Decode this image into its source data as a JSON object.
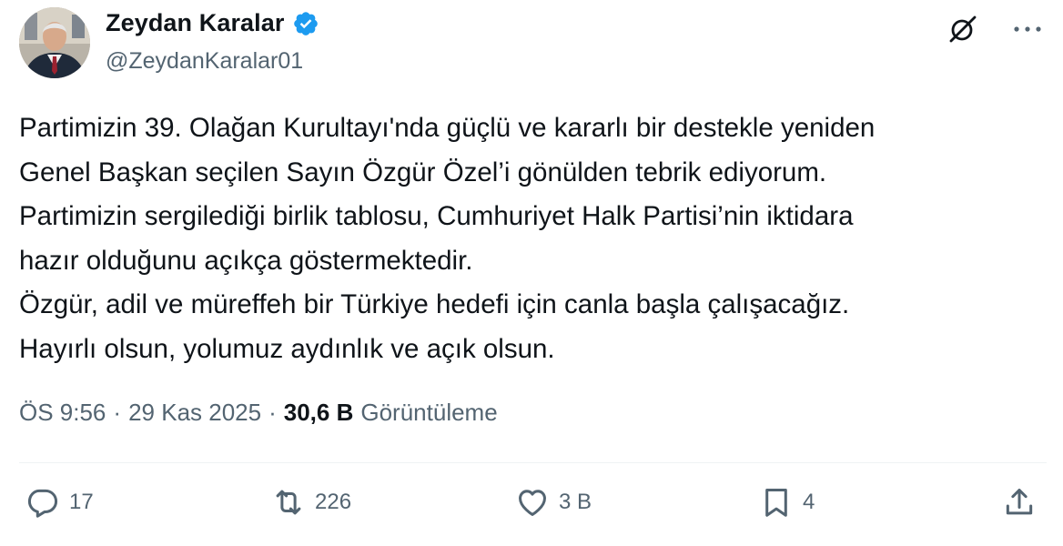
{
  "author": {
    "name": "Zeydan Karalar",
    "handle": "@ZeydanKaralar01",
    "verified": true,
    "verified_color": "#1d9bf0"
  },
  "tweet": {
    "text": "Partimizin 39. Olağan Kurultayı'nda güçlü ve kararlı bir destekle yeniden\nGenel Başkan seçilen Sayın Özgür Özel’i gönülden tebrik ediyorum.\nPartimizin sergilediği birlik tablosu, Cumhuriyet Halk Partisi’nin iktidara\nhazır olduğunu açıkça göstermektedir.\nÖzgür, adil ve müreffeh bir Türkiye hedefi için canla başla çalışacağız.\nHayırlı olsun, yolumuz aydınlık ve açık olsun."
  },
  "meta": {
    "time": "ÖS 9:56",
    "separator": "·",
    "date": "29 Kas 2025",
    "views_count": "30,6 B",
    "views_label": "Görüntüleme"
  },
  "actions": {
    "reply_count": "17",
    "repost_count": "226",
    "like_count": "3 B",
    "bookmark_count": "4"
  },
  "icons": {
    "top_right": [
      "grok-icon",
      "more-icon"
    ],
    "bar": [
      "reply-icon",
      "repost-icon",
      "like-icon",
      "bookmark-icon",
      "share-icon"
    ]
  },
  "colors": {
    "text": "#0f1419",
    "secondary": "#536471",
    "divider": "#eff3f4"
  }
}
